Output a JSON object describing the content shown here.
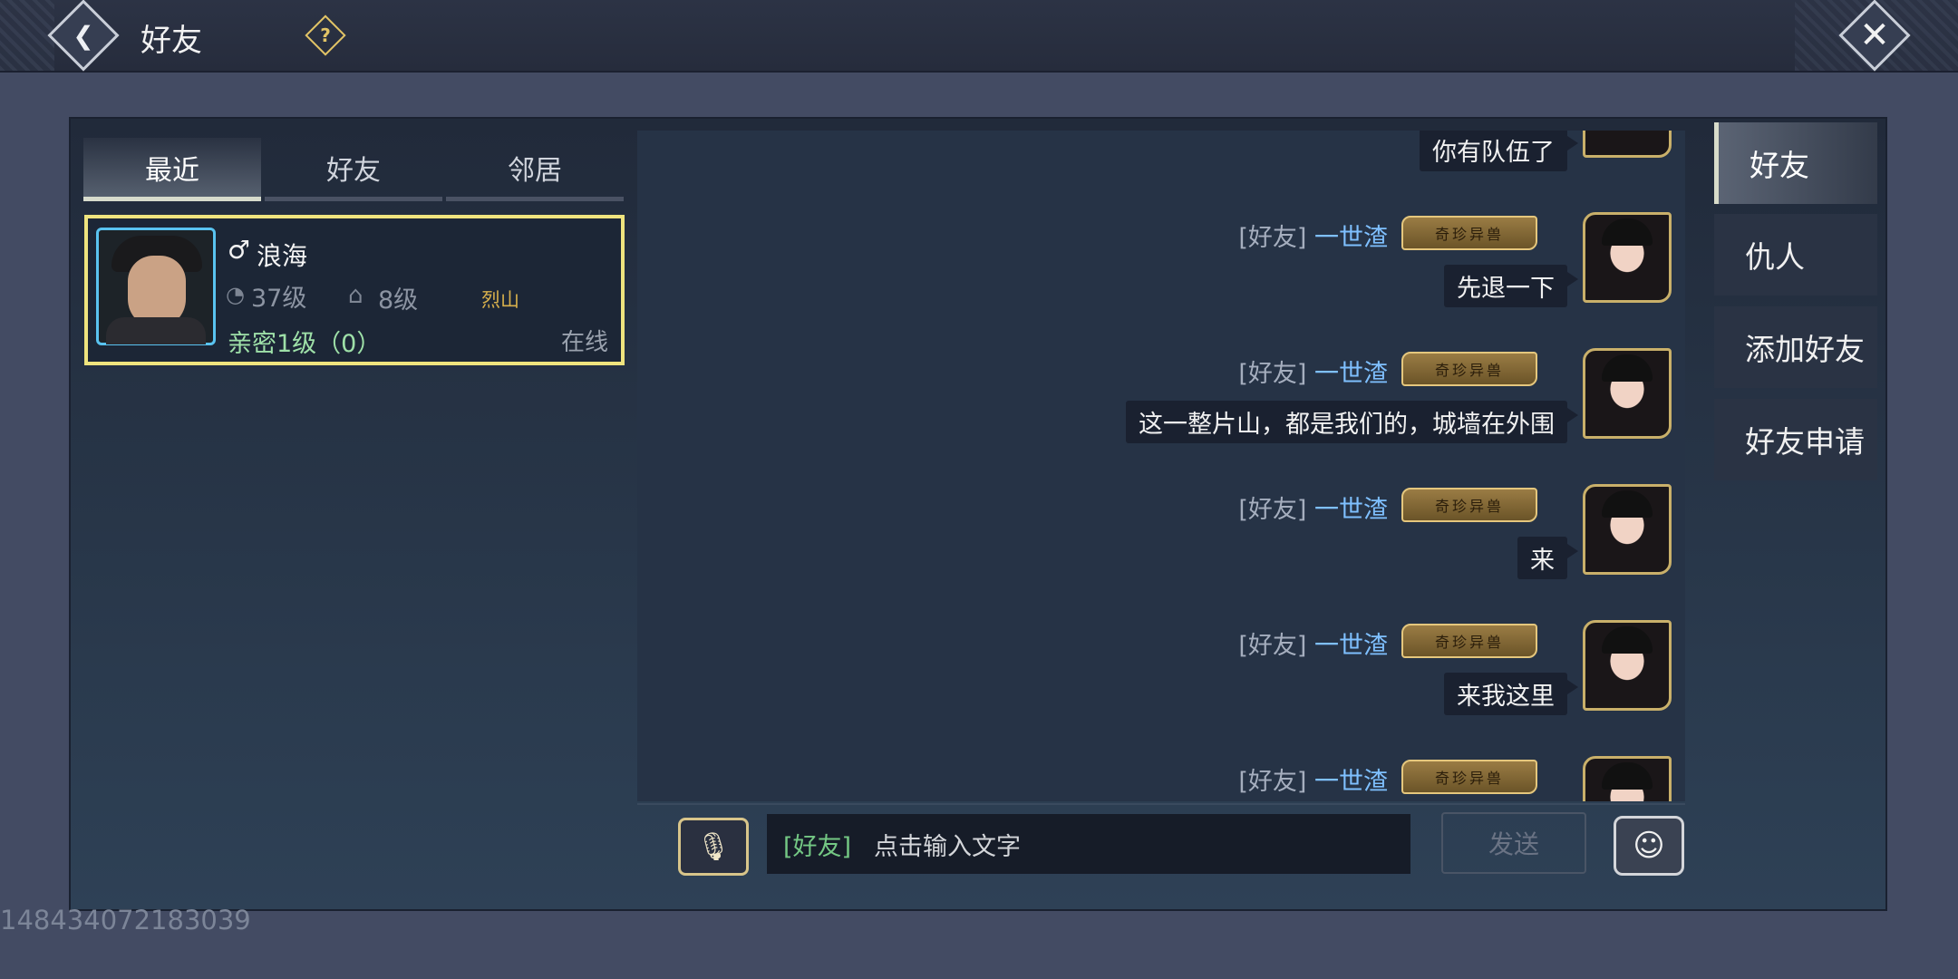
{
  "header": {
    "title": "好友",
    "help_icon": "?",
    "back_icon": "❮",
    "close_icon": "✕"
  },
  "tabs": [
    {
      "label": "最近",
      "active": true
    },
    {
      "label": "好友",
      "active": false
    },
    {
      "label": "邻居",
      "active": false
    }
  ],
  "contact": {
    "gender_icon": "♂",
    "name": "浪海",
    "level": "37级",
    "house_level": "8级",
    "sect": "烈山",
    "intimacy": "亲密1级（0）",
    "status": "在线"
  },
  "messages": [
    {
      "tag": "",
      "user": "",
      "badge": "",
      "text": "你有队伍了"
    },
    {
      "tag": "[好友]",
      "user": "一世渣",
      "badge": "奇珍异兽",
      "text": "先退一下"
    },
    {
      "tag": "[好友]",
      "user": "一世渣",
      "badge": "奇珍异兽",
      "text": "这一整片山，都是我们的，城墙在外围"
    },
    {
      "tag": "[好友]",
      "user": "一世渣",
      "badge": "奇珍异兽",
      "text": "来"
    },
    {
      "tag": "[好友]",
      "user": "一世渣",
      "badge": "奇珍异兽",
      "text": "来我这里"
    },
    {
      "tag": "[好友]",
      "user": "一世渣",
      "badge": "奇珍异兽",
      "text": ""
    }
  ],
  "input": {
    "channel": "[好友]",
    "placeholder": "点击输入文字",
    "send_label": "发送"
  },
  "side_menu": [
    {
      "label": "好友",
      "active": true
    },
    {
      "label": "仇人",
      "active": false
    },
    {
      "label": "添加好友",
      "active": false
    },
    {
      "label": "好友申请",
      "active": false
    }
  ],
  "uid": "148434072183039"
}
